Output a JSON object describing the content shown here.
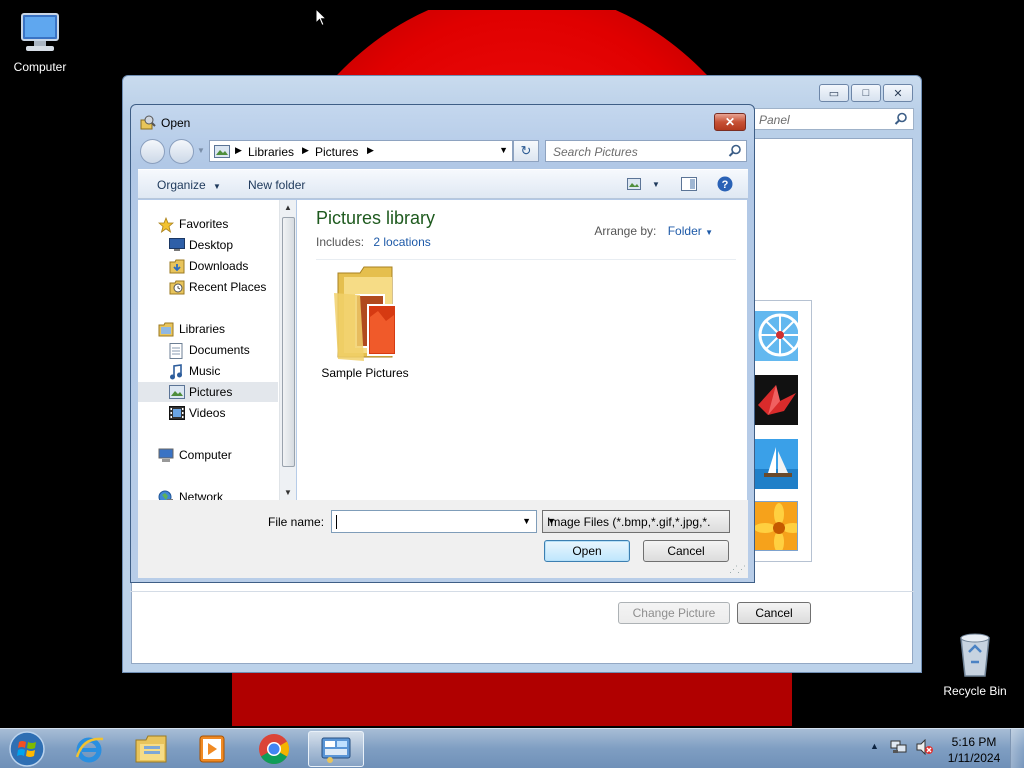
{
  "desktop": {
    "icons": [
      {
        "label": "Computer"
      },
      {
        "label": "Recycle Bin"
      }
    ]
  },
  "back_window": {
    "search_placeholder": "Panel",
    "buttons": {
      "change_picture": "Change Picture",
      "cancel": "Cancel"
    }
  },
  "dialog": {
    "title": "Open",
    "close_symbol": "✕",
    "breadcrumb": [
      "Libraries",
      "Pictures"
    ],
    "search_placeholder": "Search Pictures",
    "toolbar": {
      "organize": "Organize",
      "new_folder": "New folder"
    },
    "nav": {
      "favorites": "Favorites",
      "desktop": "Desktop",
      "downloads": "Downloads",
      "recent_places": "Recent Places",
      "libraries": "Libraries",
      "documents": "Documents",
      "music": "Music",
      "pictures": "Pictures",
      "videos": "Videos",
      "computer": "Computer",
      "network": "Network"
    },
    "content": {
      "library_title": "Pictures library",
      "includes_label": "Includes:",
      "includes_link": "2 locations",
      "arrange_label": "Arrange by:",
      "arrange_value": "Folder",
      "items": [
        {
          "name": "Sample Pictures"
        }
      ]
    },
    "footer": {
      "file_name_label": "File name:",
      "file_name_value": "",
      "file_type": "Image Files (*.bmp,*.gif,*.jpg,*.",
      "open_button": "Open",
      "cancel_button": "Cancel"
    }
  },
  "taskbar": {
    "clock_time": "5:16 PM",
    "clock_date": "1/11/2024"
  },
  "colors": {
    "wallpaper_accent": "#e00000",
    "library_title": "#1e5a1e",
    "link": "#1e5aa8",
    "dialog_close": "#c75135"
  }
}
